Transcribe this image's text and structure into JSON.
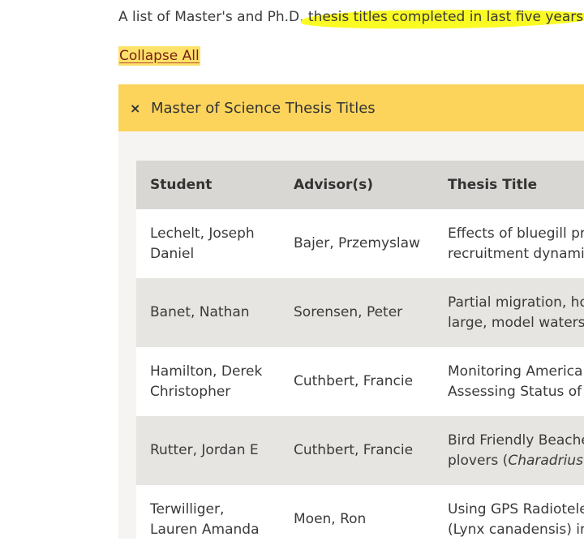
{
  "intro": {
    "text_before": "A list of Master's and Ph.D.",
    "text_highlighted": " thesis titles completed in last five years."
  },
  "collapse_all": "Collapse All",
  "accordion": {
    "icon": "close-icon",
    "icon_glyph": "×",
    "title": "Master of Science Thesis Titles"
  },
  "table": {
    "headers": [
      "Student",
      "Advisor(s)",
      "Thesis Title"
    ],
    "rows": [
      {
        "student": [
          "Lechelt, Joseph",
          "Daniel"
        ],
        "advisor": "Bajer, Przemyslaw",
        "title": [
          "Effects of bluegill pre",
          "recruitment dynamic"
        ]
      },
      {
        "student": [
          "Banet, Nathan"
        ],
        "advisor": "Sorensen, Peter",
        "title": [
          "Partial migration, hor",
          "large, model watersh"
        ]
      },
      {
        "student": [
          "Hamilton, Derek",
          "Christopher"
        ],
        "advisor": "Cuthbert, Francie",
        "title": [
          "Monitoring American",
          "Assessing Status of P"
        ]
      },
      {
        "student": [
          "Rutter, Jordan E"
        ],
        "advisor": "Cuthbert, Francie",
        "title": [
          "Bird Friendly Beaches",
          "plovers (",
          "Charadrius m"
        ]
      },
      {
        "student": [
          "Terwilliger,",
          "Lauren Amanda"
        ],
        "advisor": "Moen, Ron",
        "title": [
          "Using GPS Radiotelem",
          "(Lynx canadensis) in"
        ]
      }
    ]
  },
  "colors": {
    "highlight": "#fbfb24",
    "accordion_header": "#fcd45c",
    "table_header": "#d8d7d3",
    "row_even": "#e6e5e1",
    "link": "#7a1f12"
  }
}
